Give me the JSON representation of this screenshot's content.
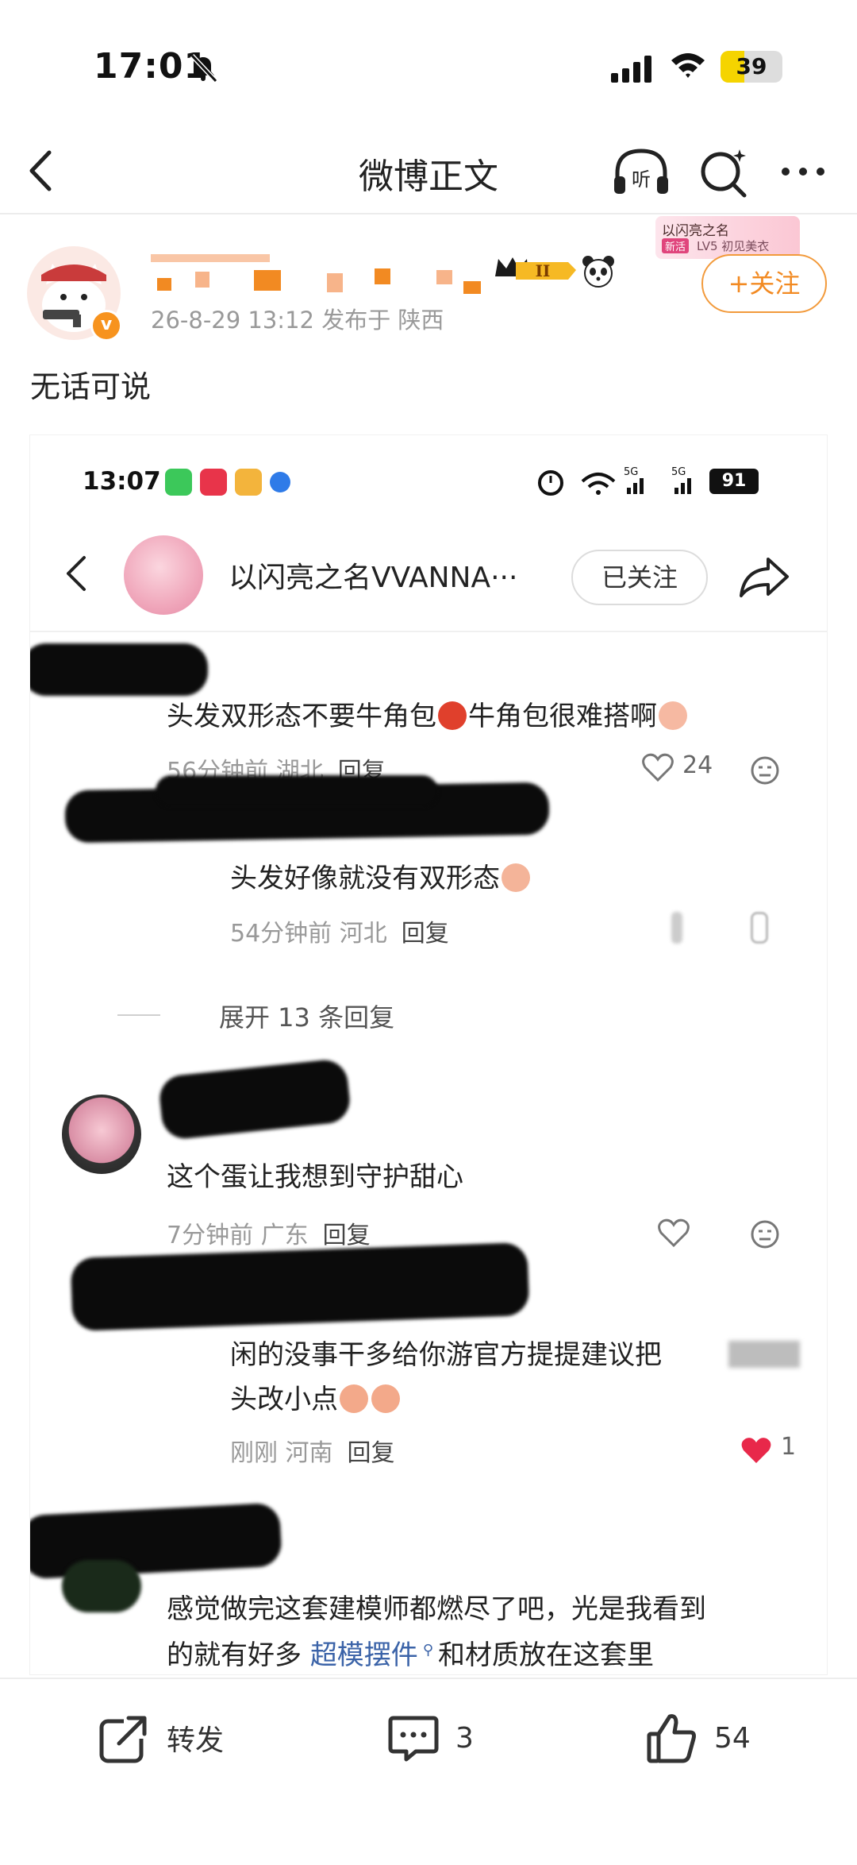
{
  "status_bar": {
    "time": "17:01",
    "battery": "39",
    "battery_level": 0.39
  },
  "nav": {
    "title": "微博正文"
  },
  "author": {
    "meta": "26-8-29 13:12  发布于 陕西",
    "follow_label": "+关注",
    "promo_line1": "以闪亮之名",
    "promo_tag": "新活",
    "promo_line2": "LV5 初见美衣"
  },
  "post": {
    "text": "无话可说"
  },
  "embedded": {
    "time": "13:07",
    "battery": "91",
    "channel_name": "以闪亮之名VVANNA···",
    "followed_label": "已关注",
    "comments": [
      {
        "text_a": "头发双形态不要牛角包",
        "text_b": "牛角包很难搭啊",
        "meta": "56分钟前 湖北",
        "reply": "回复",
        "likes": "24"
      },
      {
        "text": "头发好像就没有双形态",
        "meta": "54分钟前 河北",
        "reply": "回复"
      },
      {
        "expand": "展开 13 条回复"
      },
      {
        "text": "这个蛋让我想到守护甜心",
        "meta": "7分钟前 广东",
        "reply": "回复"
      },
      {
        "line1": "闲的没事干多给你游官方提提建议把",
        "line2": "头改小点",
        "meta": "刚刚 河南",
        "reply": "回复",
        "likes": "1"
      },
      {
        "line1": "感觉做完这套建模师都燃尽了吧，光是我看到",
        "line2a": "的就有好多",
        "link": "超模摆件",
        "line2b": "和材质放在这套里"
      }
    ]
  },
  "toolbar": {
    "repost": "转发",
    "comments": "3",
    "likes": "54"
  }
}
